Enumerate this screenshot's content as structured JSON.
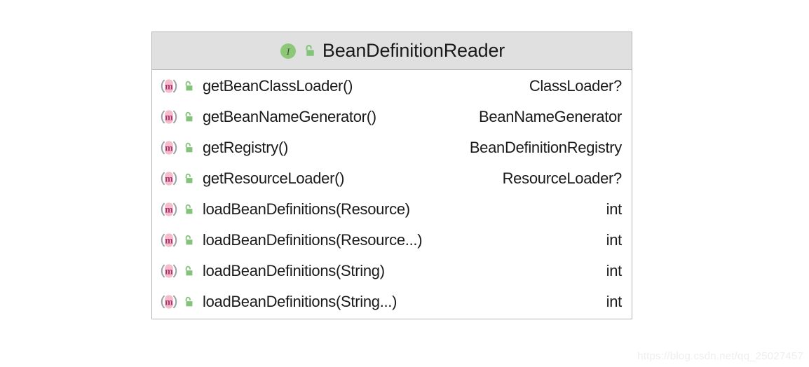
{
  "diagram": {
    "type": "uml-class-diagram",
    "colors": {
      "header_background": "#e0e0e0",
      "body_background": "#ffffff",
      "border": "#b4b4b4",
      "interface_icon_green": "#8cc878",
      "lock_icon_green": "#84c47a",
      "method_icon_pink": "#f7bcca",
      "method_icon_letter": "#a8336e",
      "method_icon_arc_gray": "#9aa0a6",
      "text": "#1a1a1a",
      "watermark": "#eeeeee"
    },
    "class_box": {
      "stereotype": "interface",
      "title": "BeanDefinitionReader",
      "title_icons": [
        {
          "name": "interface-icon",
          "glyph": "I",
          "tooltip": "Interface"
        },
        {
          "name": "public-visibility-icon",
          "glyph": "unlocked-padlock",
          "tooltip": "public"
        }
      ],
      "members": [
        {
          "icons": [
            "method-icon",
            "public-visibility-icon"
          ],
          "name": "getBeanClassLoader()",
          "type": "ClassLoader?"
        },
        {
          "icons": [
            "method-icon",
            "public-visibility-icon"
          ],
          "name": "getBeanNameGenerator()",
          "type": "BeanNameGenerator"
        },
        {
          "icons": [
            "method-icon",
            "public-visibility-icon"
          ],
          "name": "getRegistry()",
          "type": "BeanDefinitionRegistry"
        },
        {
          "icons": [
            "method-icon",
            "public-visibility-icon"
          ],
          "name": "getResourceLoader()",
          "type": "ResourceLoader?"
        },
        {
          "icons": [
            "method-icon",
            "public-visibility-icon"
          ],
          "name": "loadBeanDefinitions(Resource)",
          "type": "int"
        },
        {
          "icons": [
            "method-icon",
            "public-visibility-icon"
          ],
          "name": "loadBeanDefinitions(Resource...)",
          "type": "int"
        },
        {
          "icons": [
            "method-icon",
            "public-visibility-icon"
          ],
          "name": "loadBeanDefinitions(String)",
          "type": "int"
        },
        {
          "icons": [
            "method-icon",
            "public-visibility-icon"
          ],
          "name": "loadBeanDefinitions(String...)",
          "type": "int"
        }
      ]
    }
  },
  "watermark": {
    "text": "https://blog.csdn.net/qq_25027457"
  }
}
